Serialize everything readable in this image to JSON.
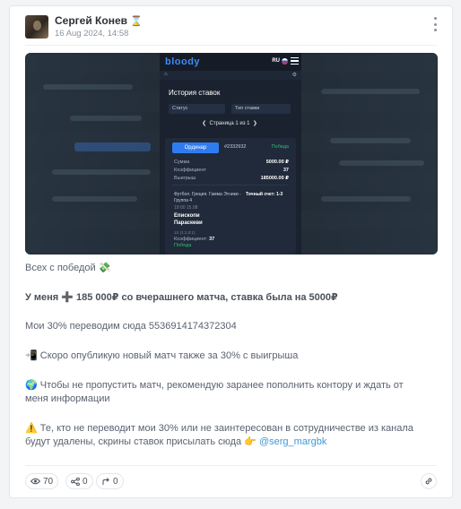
{
  "post": {
    "author": "Сергей Конев",
    "author_badge": "⌛",
    "date": "16 Aug 2024, 14:58",
    "lines": [
      "Всех с победой 💸",
      "У меня ➕ 185 000₽ со вчерашнего матча, ставка была на 5000₽",
      "Мои 30% переводим сюда 5536914174372304",
      "📲 Скоро опубликую новый матч также за 30% с выигрыша",
      "🌍 Чтобы не пропустить матч, рекомендую заранее пополнить контору и ждать от меня информации",
      "⚠️ Те, кто не переводит мои 30% или не заинтересован в сотрудничестве из канала будут удалены, скрины ставок присылать сюда 👉"
    ],
    "mention": "@serg_margbk"
  },
  "screenshot": {
    "logo": "bloody",
    "lang": "RU",
    "sub_left": "⌂",
    "sub_right": "⚙",
    "title": "История ставок",
    "filter_status": "Статус",
    "filter_type": "Тип ставки",
    "pager": "Страница 1 из 1",
    "pager_prev": "❮",
    "pager_next": "❯",
    "bet_type": "Ординар",
    "bet_id": "#2332932",
    "result": "Победа",
    "amount_label": "Сумма",
    "amount_value": "5000.00 ₽",
    "coef_label": "Коэффициент",
    "coef_value": "37",
    "payout_label": "Выигрыш",
    "payout_value": "185000.00 ₽",
    "event": "Футбол. Греция. Гамма Этники - Группа 4",
    "event_time": "19:00 15.08",
    "market": "Точный счет: 1-3",
    "team1": "Епископи",
    "team2": "Параскеви",
    "meta": "1X (1:2,0:1)",
    "coef_line_label": "Коэффициент:",
    "coef_line_value": "37",
    "won_label": "Победа"
  },
  "stats": {
    "views": "70",
    "shares": "0",
    "forwards": "0"
  }
}
